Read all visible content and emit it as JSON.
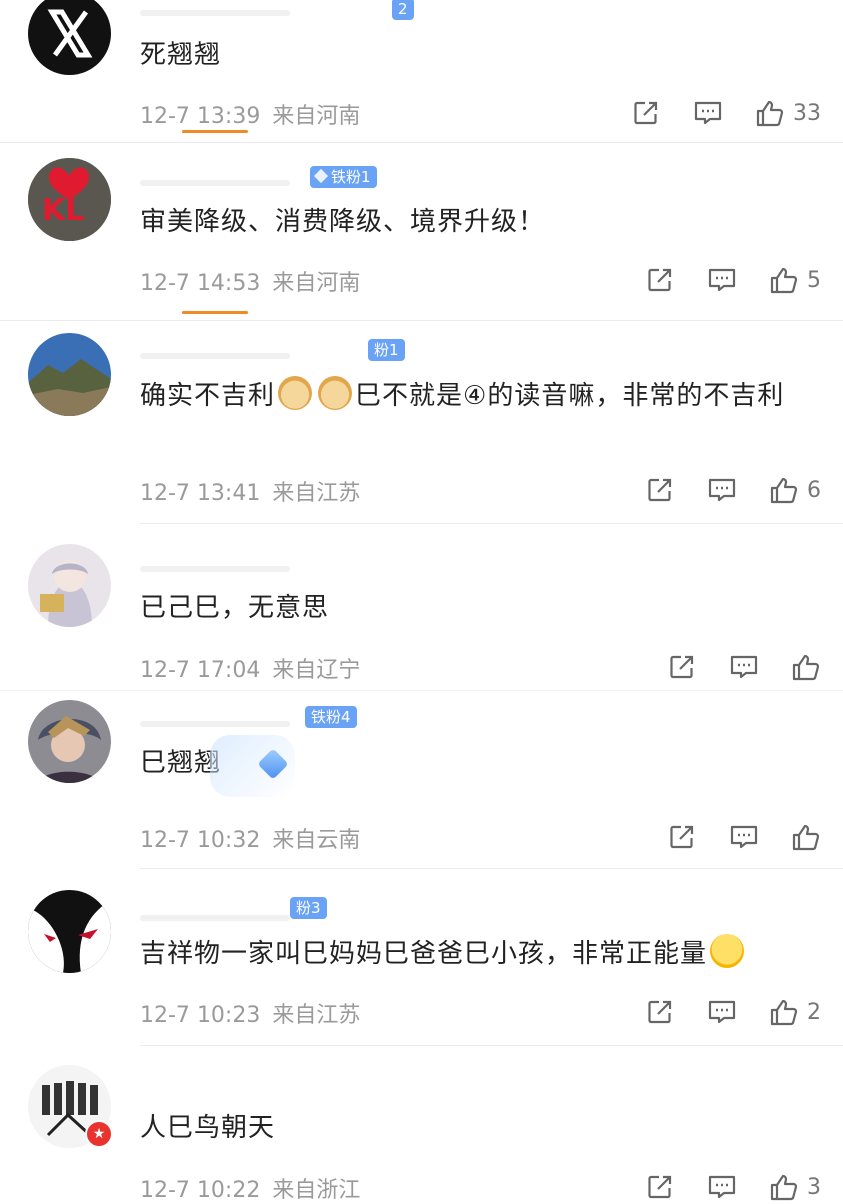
{
  "colors": {
    "badge": "#6aa3f5",
    "accent": "#f08a24",
    "meta": "#9a9a9a"
  },
  "comments": [
    {
      "badge": "2",
      "text": "死翘翘",
      "date": "12-7",
      "time": "13:39",
      "location": "来自河南",
      "likes": "33"
    },
    {
      "badge": "铁粉1",
      "text": "审美降级、消费降级、境界升级！",
      "date": "12-7",
      "time": "14:53",
      "location": "来自河南",
      "likes": "5"
    },
    {
      "badge": "粉1",
      "text_a": "确实不吉利",
      "text_b": "巳不就是④的读音嘛，非常的不吉利",
      "date": "12-7",
      "time": "13:41",
      "location": "来自江苏",
      "likes": "6"
    },
    {
      "text": "已己巳，无意思",
      "date": "12-7",
      "time": "17:04",
      "location": "来自辽宁",
      "likes": ""
    },
    {
      "badge": "铁粉4",
      "text": "巳翘翘",
      "date": "12-7",
      "time": "10:32",
      "location": "来自云南",
      "likes": ""
    },
    {
      "badge": "粉3",
      "text": "吉祥物一家叫巳妈妈巳爸爸巳小孩，非常正能量",
      "date": "12-7",
      "time": "10:23",
      "location": "来自江苏",
      "likes": "2"
    },
    {
      "text": "人巳鸟朝天",
      "date": "12-7",
      "time": "10:22",
      "location": "来自浙江",
      "likes": "3"
    }
  ],
  "icons": {
    "share": "share-icon",
    "reply": "comment-icon",
    "like": "thumbs-up-icon",
    "emoji_doge": "doge-emoji",
    "emoji_smile": "smile-emoji"
  }
}
